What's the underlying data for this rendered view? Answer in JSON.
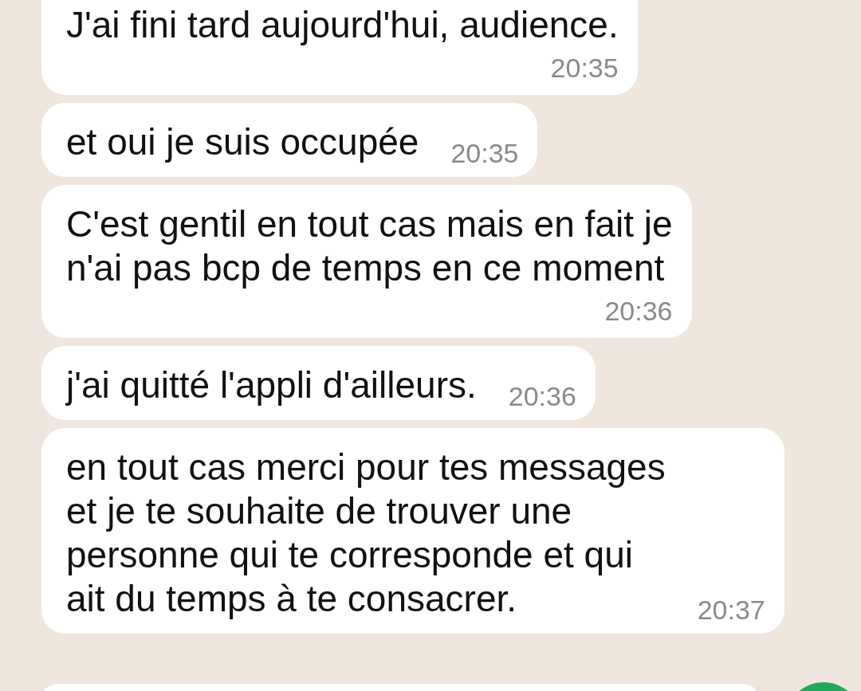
{
  "messages": [
    {
      "lines": [
        "J'ai fini tard aujourd'hui, audience."
      ],
      "time": "20:35",
      "kind": "below"
    },
    {
      "lines": [
        "et oui je suis occupée"
      ],
      "time": "20:35",
      "kind": "inline"
    },
    {
      "lines": [
        "C'est gentil en tout cas mais en fait je",
        "n'ai pas bcp de temps en ce moment"
      ],
      "time": "20:36",
      "kind": "below"
    },
    {
      "lines": [
        "j'ai quitté l'appli d'ailleurs."
      ],
      "time": "20:36",
      "kind": "inline"
    },
    {
      "lines": [
        "en tout cas merci pour tes messages",
        "et je te souhaite de trouver une",
        "personne qui te corresponde et qui",
        "ait du temps à te consacrer."
      ],
      "time": "20:37",
      "kind": "inline"
    }
  ]
}
